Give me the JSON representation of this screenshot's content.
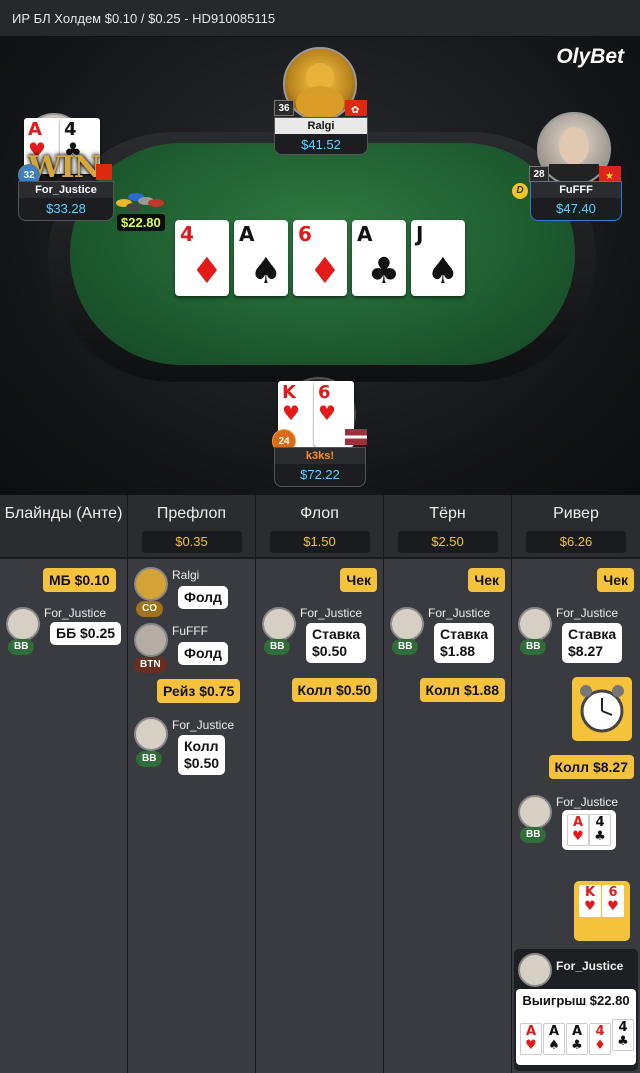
{
  "header": {
    "title": "ИР БЛ Холдем $0.10 / $0.25   - HD910085115"
  },
  "brand": {
    "name": "OlyBet"
  },
  "board": [
    {
      "rank": "4",
      "suit": "♦",
      "color": "red"
    },
    {
      "rank": "A",
      "suit": "♠",
      "color": "black"
    },
    {
      "rank": "6",
      "suit": "♦",
      "color": "red"
    },
    {
      "rank": "A",
      "suit": "♣",
      "color": "black"
    },
    {
      "rank": "J",
      "suit": "♠",
      "color": "black"
    }
  ],
  "seats": {
    "top": {
      "name": "Ralgi",
      "stack": "$41.52",
      "level": "36"
    },
    "left": {
      "name": "For_Justice",
      "stack": "$33.28",
      "level": "32",
      "bet": "$22.80",
      "win_label": "WIN",
      "cards": [
        {
          "rank": "A",
          "suit": "♥",
          "color": "red"
        },
        {
          "rank": "4",
          "suit": "♣",
          "color": "black"
        }
      ]
    },
    "right": {
      "name": "FuFFF",
      "stack": "$47.40",
      "level": "28",
      "dealer": "D"
    },
    "bottom": {
      "name": "k3ks!",
      "stack": "$72.22",
      "level": "24",
      "cards": [
        {
          "rank": "K",
          "suit": "♥",
          "color": "red"
        },
        {
          "rank": "6",
          "suit": "♥",
          "color": "red"
        }
      ]
    }
  },
  "history": {
    "columns": [
      {
        "title": "Блайнды (Анте)",
        "pot": ""
      },
      {
        "title": "Префлоп",
        "pot": "$0.35"
      },
      {
        "title": "Флоп",
        "pot": "$1.50"
      },
      {
        "title": "Тёрн",
        "pot": "$2.50"
      },
      {
        "title": "Ривер",
        "pot": "$6.26"
      }
    ],
    "blinds": {
      "sb": "МБ $0.10",
      "bb_player": "For_Justice",
      "bb_pos": "BB",
      "bb": "ББ $0.25"
    },
    "preflop": {
      "p1_name": "Ralgi",
      "p1_pos": "CO",
      "p1_action": "Фолд",
      "p2_name": "FuFFF",
      "p2_pos": "BTN",
      "p2_action": "Фолд",
      "raise": "Рейз $0.75",
      "p3_name": "For_Justice",
      "p3_pos": "BB",
      "p3_action_1": "Колл",
      "p3_action_2": "$0.50"
    },
    "flop": {
      "check": "Чек",
      "p_name": "For_Justice",
      "p_pos": "BB",
      "bet_1": "Ставка",
      "bet_2": "$0.50",
      "call": "Колл $0.50"
    },
    "turn": {
      "check": "Чек",
      "p_name": "For_Justice",
      "p_pos": "BB",
      "bet_1": "Ставка",
      "bet_2": "$1.88",
      "call": "Колл $1.88"
    },
    "river": {
      "check": "Чек",
      "p_name": "For_Justice",
      "p_pos": "BB",
      "bet_1": "Ставка",
      "bet_2": "$8.27",
      "call": "Колл $8.27",
      "show_name": "For_Justice",
      "show_pos": "BB",
      "show_cards": [
        {
          "rank": "A",
          "suit": "♥",
          "color": "red"
        },
        {
          "rank": "4",
          "suit": "♣",
          "color": "black"
        }
      ],
      "opp_cards": [
        {
          "rank": "K",
          "suit": "♥",
          "color": "red"
        },
        {
          "rank": "6",
          "suit": "♥",
          "color": "red"
        }
      ],
      "winner_name": "For_Justice",
      "win_text": "Выигрыш $22.80",
      "win_cards": [
        {
          "rank": "A",
          "suit": "♥",
          "color": "red"
        },
        {
          "rank": "A",
          "suit": "♠",
          "color": "black"
        },
        {
          "rank": "A",
          "suit": "♣",
          "color": "black"
        },
        {
          "rank": "4",
          "suit": "♦",
          "color": "red"
        },
        {
          "rank": "4",
          "suit": "♣",
          "color": "black"
        }
      ]
    }
  }
}
